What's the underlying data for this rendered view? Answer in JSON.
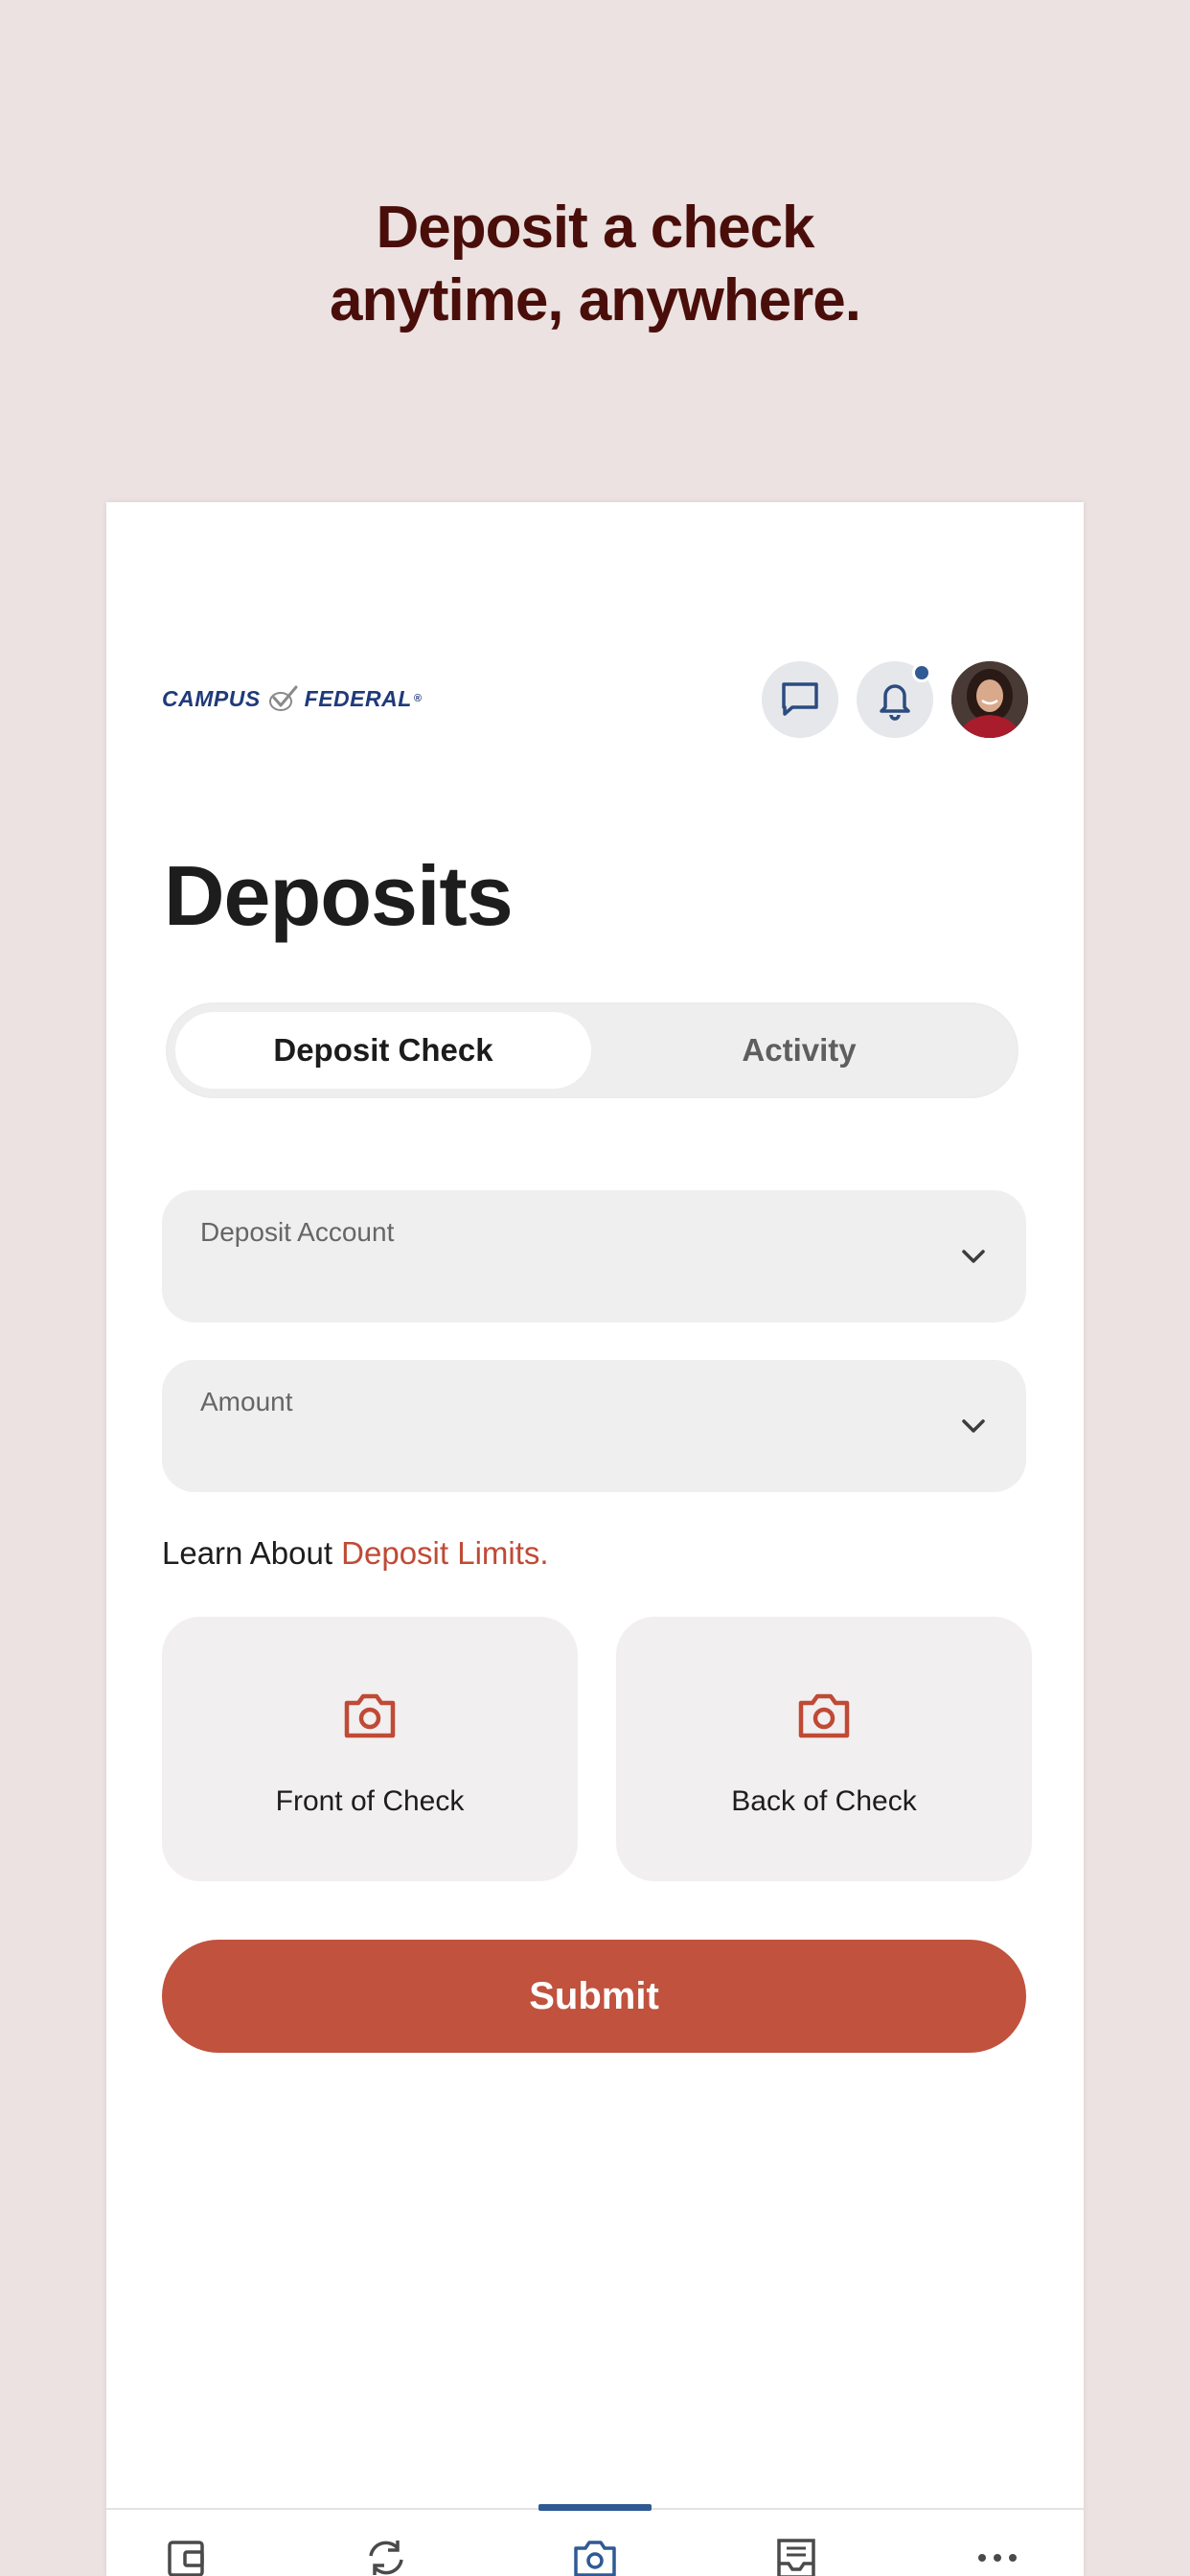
{
  "promo": {
    "line1": "Deposit a check",
    "line2": "anytime, anywhere."
  },
  "header": {
    "logo_left": "CAMPUS",
    "logo_right": "FEDERAL",
    "logo_reg": "®",
    "brand_color": "#1f3a7a",
    "notification_dot": true
  },
  "page": {
    "title": "Deposits"
  },
  "tabs": [
    {
      "label": "Deposit Check",
      "active": true
    },
    {
      "label": "Activity",
      "active": false
    }
  ],
  "form": {
    "deposit_account_label": "Deposit Account",
    "amount_label": "Amount",
    "learn_prefix": "Learn About ",
    "learn_link": "Deposit Limits.",
    "front_label": "Front of Check",
    "back_label": "Back of Check",
    "submit_label": "Submit"
  },
  "colors": {
    "accent": "#c0523e",
    "headline": "#4a0e0a",
    "nav_active": "#2f5a94",
    "background": "#ebe2e1"
  },
  "bottom_nav": [
    {
      "icon": "wallet-icon",
      "active": false
    },
    {
      "icon": "transfer-icon",
      "active": false
    },
    {
      "icon": "camera-icon",
      "active": true
    },
    {
      "icon": "statements-icon",
      "active": false
    },
    {
      "icon": "more-icon",
      "active": false
    }
  ]
}
